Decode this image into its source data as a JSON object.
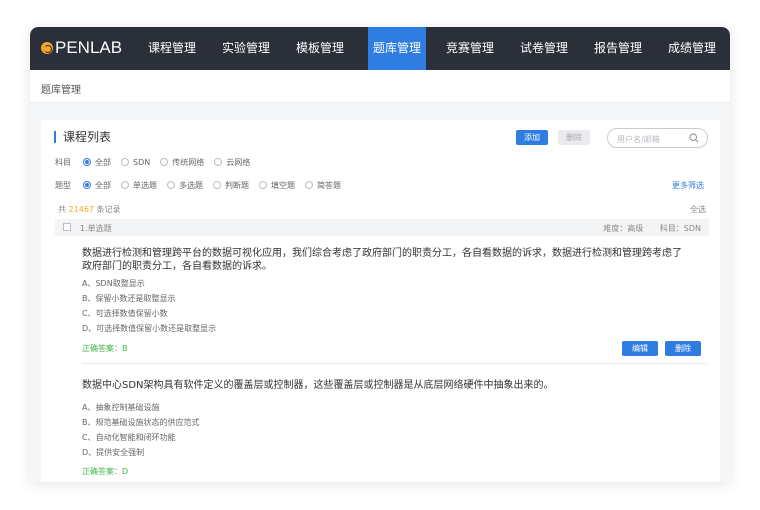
{
  "brand": {
    "logo_text": "PENLAB",
    "accent": "#2f7de1",
    "logo_color": "#f5a623"
  },
  "nav": {
    "items": [
      {
        "label": "课程管理"
      },
      {
        "label": "实验管理"
      },
      {
        "label": "模板管理"
      },
      {
        "label": "题库管理",
        "active": true
      },
      {
        "label": "竞赛管理"
      },
      {
        "label": "试卷管理"
      },
      {
        "label": "报告管理"
      },
      {
        "label": "成绩管理"
      }
    ]
  },
  "breadcrumb": {
    "title": "题库管理"
  },
  "card": {
    "title": "课程列表",
    "add_label": "添加",
    "delete_label": "删除",
    "search_placeholder": "用户名/邮箱"
  },
  "filters": {
    "subject": {
      "label": "科目",
      "options": [
        "全部",
        "SDN",
        "传统网络",
        "云网络"
      ],
      "selected": "全部"
    },
    "qtype": {
      "label": "题型",
      "options": [
        "全部",
        "单选题",
        "多选题",
        "判断题",
        "填空题",
        "简答题"
      ],
      "selected": "全部"
    },
    "more_label": "更多筛选"
  },
  "summary": {
    "prefix": "共",
    "count": "21467",
    "suffix": "条记录",
    "select_all": "全选"
  },
  "question_header": {
    "type": "1.单选题",
    "difficulty": "难度：高级",
    "subject": "科目：SDN"
  },
  "questions": [
    {
      "line1": "数据进行检测和管理跨平台的数据可视化应用，我们综合考虑了政府部门的职责分工，各自看数据的诉求，数据进行检测和管理跨考虑了",
      "line2": "政府部门的职责分工，各自看数据的诉求。",
      "options": [
        "A、SDN取整显示",
        "B、保留小数还是取整显示",
        "C、可选择数值保留小数",
        "D、可选择数值保留小数还是取整显示"
      ],
      "answer": "正确答案：B",
      "edit_label": "编辑",
      "delete_label": "删除"
    },
    {
      "line1": "数据中心SDN架构具有软件定义的覆盖层或控制器，这些覆盖层或控制器是从底层网络硬件中抽象出来的。",
      "options": [
        "A、抽象控制基础设施",
        "B、规范基础设施状态的供应范式",
        "C、自动化智能和闭环功能",
        "D、提供安全强制"
      ],
      "answer": "正确答案：D"
    }
  ]
}
